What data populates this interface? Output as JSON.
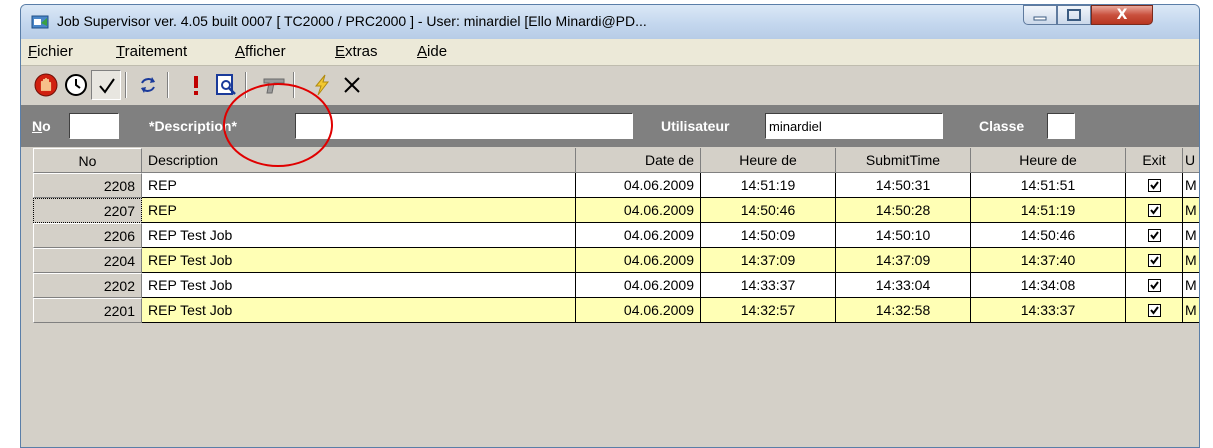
{
  "window": {
    "title": "Job Supervisor ver. 4.05 built 0007    [ TC2000 / PRC2000 ] - User: minardiel [Ello Minardi@PD...",
    "close_label": "X"
  },
  "menu": [
    {
      "label": "Fichier",
      "key": "F",
      "rest": "ichier"
    },
    {
      "label": "Traitement",
      "key": "T",
      "rest": "raitement"
    },
    {
      "label": "Afficher",
      "key": "A",
      "rest": "fficher"
    },
    {
      "label": "Extras",
      "key": "E",
      "rest": "xtras"
    },
    {
      "label": "Aide",
      "key": "A",
      "rest": "ide"
    }
  ],
  "toolbar": {
    "icons": [
      "stop-hand-icon",
      "clock-icon",
      "checkmark-icon",
      "refresh-icon",
      "exclamation-icon",
      "preview-search-icon",
      "pistol-icon",
      "lightning-icon",
      "close-x-icon"
    ]
  },
  "filter": {
    "no_label": "No",
    "no_key": "N",
    "no_rest": "o",
    "no_value": "",
    "description_label": "*Description*",
    "description_value": "",
    "user_label": "Utilisateur",
    "user_value": "minardiel",
    "class_label": "Classe",
    "class_value": ""
  },
  "table": {
    "headers": {
      "no": "No",
      "description": "Description",
      "date": "Date de",
      "heure1": "Heure de",
      "submit": "SubmitTime",
      "heure2": "Heure de",
      "exit": "Exit",
      "u": "U"
    },
    "rows": [
      {
        "no": "2208",
        "description": "REP",
        "date": "04.06.2009",
        "heure1": "14:51:19",
        "submit": "14:50:31",
        "heure2": "14:51:51",
        "exit": true,
        "u": "M"
      },
      {
        "no": "2207",
        "description": "REP",
        "date": "04.06.2009",
        "heure1": "14:50:46",
        "submit": "14:50:28",
        "heure2": "14:51:19",
        "exit": true,
        "u": "M"
      },
      {
        "no": "2206",
        "description": "REP Test Job",
        "date": "04.06.2009",
        "heure1": "14:50:09",
        "submit": "14:50:10",
        "heure2": "14:50:46",
        "exit": true,
        "u": "M"
      },
      {
        "no": "2204",
        "description": "REP Test Job",
        "date": "04.06.2009",
        "heure1": "14:37:09",
        "submit": "14:37:09",
        "heure2": "14:37:40",
        "exit": true,
        "u": "M"
      },
      {
        "no": "2202",
        "description": "REP Test Job",
        "date": "04.06.2009",
        "heure1": "14:33:37",
        "submit": "14:33:04",
        "heure2": "14:34:08",
        "exit": true,
        "u": "M"
      },
      {
        "no": "2201",
        "description": "REP Test Job",
        "date": "04.06.2009",
        "heure1": "14:32:57",
        "submit": "14:32:58",
        "heure2": "14:33:37",
        "exit": true,
        "u": "M"
      }
    ]
  },
  "colors": {
    "row_highlight": "#ffffb5",
    "annotation_circle": "#e00000",
    "filter_bar": "#808080"
  }
}
